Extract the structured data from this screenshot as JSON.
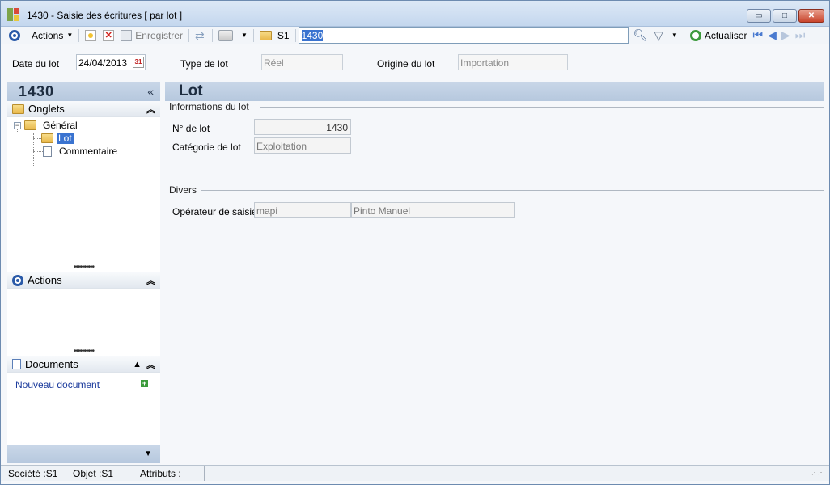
{
  "window": {
    "title": "1430 -  Saisie des écritures [ par lot ]",
    "controls": {
      "minimize": "▭",
      "maximize": "□",
      "close": "✕"
    }
  },
  "toolbar": {
    "actions_label": "Actions",
    "save_label": "Enregistrer",
    "company_label": "S1",
    "search_value": "1430",
    "refresh_label": "Actualiser"
  },
  "header": {
    "date_label": "Date du lot",
    "date_value": "24/04/2013",
    "calendar_day": "31",
    "type_label": "Type de lot",
    "type_value": "Réel",
    "origin_label": "Origine du lot",
    "origin_value": "Importation"
  },
  "sidebar": {
    "record_number": "1430",
    "collapse_glyph": "«",
    "tabs_title": "Onglets",
    "tree": {
      "root": "Général",
      "children": [
        "Lot",
        "Commentaire"
      ]
    },
    "actions_title": "Actions",
    "documents_title": "Documents",
    "new_document_label": "Nouveau document",
    "footer_glyph": "▼"
  },
  "main": {
    "title": "Lot",
    "info_group": {
      "title": "Informations du lot",
      "lot_number_label": "N° de lot",
      "lot_number_value": "1430",
      "category_label": "Catégorie de lot",
      "category_value": "Exploitation"
    },
    "misc_group": {
      "title": "Divers",
      "operator_label": "Opérateur de saisie",
      "operator_code": "mapi",
      "operator_name": "Pinto Manuel"
    }
  },
  "statusbar": {
    "company": "Société :S1",
    "object": "Objet :S1",
    "attributes": "Attributs :"
  },
  "colors": {
    "accent": "#3a73d0",
    "panel_header": "#c9d7e8",
    "close_button": "#c9442c"
  }
}
